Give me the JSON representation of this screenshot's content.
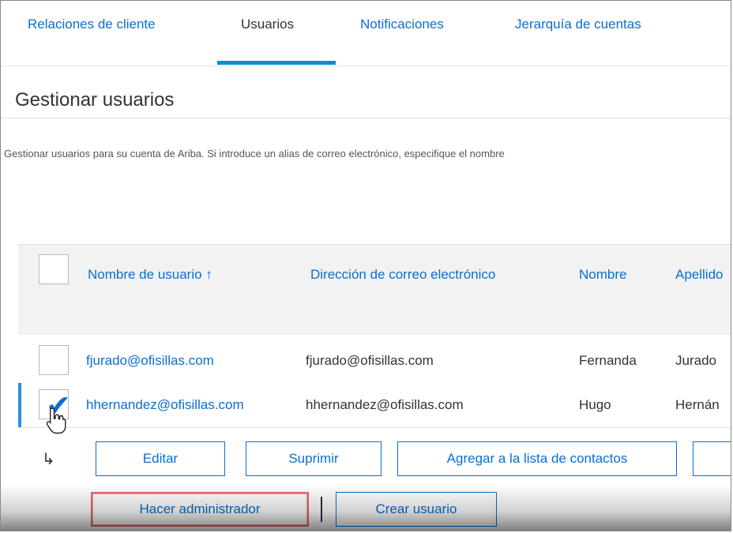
{
  "tabs": [
    {
      "label": "Relaciones de cliente",
      "active": false
    },
    {
      "label": "Usuarios",
      "active": true
    },
    {
      "label": "Notificaciones",
      "active": false
    },
    {
      "label": "Jerarquía de cuentas",
      "active": false
    }
  ],
  "section": {
    "title": "Gestionar usuarios",
    "description": "Gestionar usuarios para su cuenta de Ariba. Si introduce un alias de correo electrónico, especifique el nombre"
  },
  "table": {
    "columns": {
      "username": "Nombre de usuario ↑",
      "email": "Dirección de correo electrónico",
      "first": "Nombre",
      "last": "Apellido"
    },
    "rows": [
      {
        "username": "fjurado@ofisillas.com",
        "email": "fjurado@ofisillas.com",
        "first": "Fernanda",
        "last": "Jurado",
        "selected": false
      },
      {
        "username": "hhernandez@ofisillas.com",
        "email": "hhernandez@ofisillas.com",
        "first": "Hugo",
        "last": "Hernán",
        "selected": true
      }
    ]
  },
  "actions": {
    "arrow": "↳",
    "edit": "Editar",
    "delete": "Suprimir",
    "add_contacts": "Agregar a la lista de contactos",
    "make_admin": "Hacer administrador",
    "create_user": "Crear usuario"
  },
  "colors": {
    "link": "#0a6ed1",
    "accent": "#0a8ed9",
    "highlight_outline": "#e06a6a"
  }
}
